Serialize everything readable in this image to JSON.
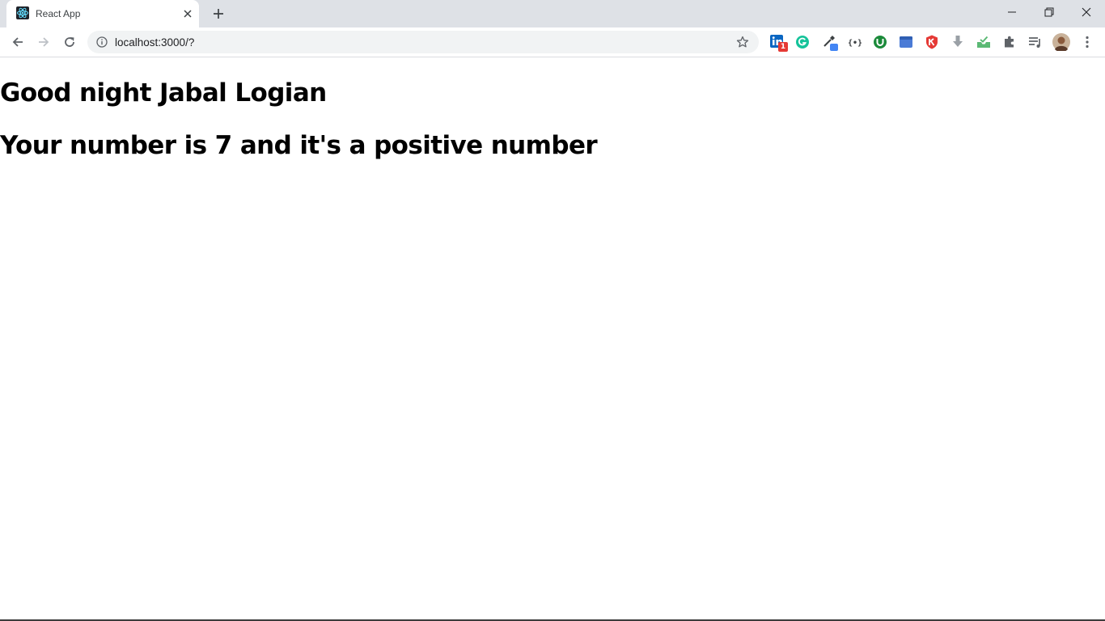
{
  "browser": {
    "tab": {
      "title": "React App",
      "favicon": "react-logo-icon"
    },
    "new_tab_icon": "plus-icon",
    "window_controls": [
      "minimize-icon",
      "restore-icon",
      "close-icon"
    ],
    "address_bar": {
      "url": "localhost:3000/?"
    },
    "extensions": [
      {
        "name": "linkedin-extension-icon",
        "badge": "1",
        "color": "#0a66c2"
      },
      {
        "name": "grammarly-extension-icon",
        "color": "#15c39a"
      },
      {
        "name": "eyedropper-extension-icon",
        "color": "#4285f4"
      },
      {
        "name": "json-formatter-extension-icon",
        "color": "#3c4043"
      },
      {
        "name": "utorrent-extension-icon",
        "color": "#1b8a3a"
      },
      {
        "name": "blue-box-extension-icon",
        "color": "#4a7bd6"
      },
      {
        "name": "red-shield-extension-icon",
        "color": "#e53935"
      },
      {
        "name": "download-extension-icon",
        "color": "#9aa0a6"
      },
      {
        "name": "green-tray-extension-icon",
        "color": "#5bb974"
      },
      {
        "name": "puzzle-extensions-icon",
        "color": "#5f6368"
      },
      {
        "name": "media-queue-icon",
        "color": "#5f6368"
      }
    ],
    "profile": "avatar",
    "menu": "kebab-menu-icon"
  },
  "page": {
    "greeting": "Good night Jabal Logian",
    "number_message": "Your number is 7 and it's a positive number"
  },
  "colors": {
    "tabstrip_bg": "#dee1e6",
    "omnibox_bg": "#f1f3f4",
    "react_blue": "#61dafb"
  }
}
